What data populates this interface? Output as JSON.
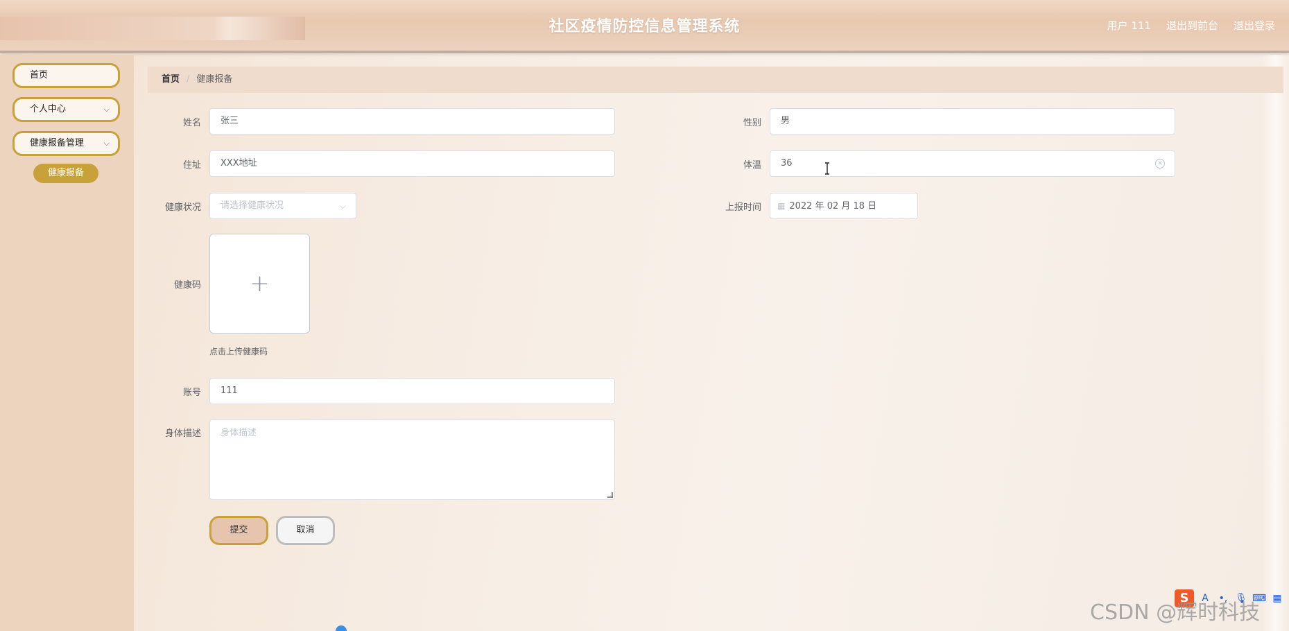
{
  "header": {
    "title": "社区疫情防控信息管理系统",
    "user": "用户 111",
    "back_to_front": "退出到前台",
    "logout": "退出登录"
  },
  "sidebar": {
    "items": [
      {
        "label": "首页"
      },
      {
        "label": "个人中心"
      },
      {
        "label": "健康报备管理"
      }
    ],
    "sub_items": [
      {
        "label": "健康报备"
      }
    ]
  },
  "breadcrumb": {
    "home": "首页",
    "separator": "/",
    "current": "健康报备"
  },
  "form": {
    "name": {
      "label": "姓名",
      "value": "张三"
    },
    "gender": {
      "label": "性别",
      "value": "男"
    },
    "address": {
      "label": "住址",
      "value": "XXX地址"
    },
    "temperature": {
      "label": "体温",
      "value": "36"
    },
    "health_status": {
      "label": "健康状况",
      "placeholder": "请选择健康状况"
    },
    "report_time": {
      "label": "上报时间",
      "value": "2022 年 02 月 18 日"
    },
    "health_code": {
      "label": "健康码",
      "upload_tip": "点击上传健康码"
    },
    "account": {
      "label": "账号",
      "value": "111"
    },
    "description": {
      "label": "身体描述",
      "placeholder": "身体描述"
    },
    "submit": "提交",
    "cancel": "取消"
  },
  "overlay": {
    "watermark": "CSDN @辉时科技",
    "ime_logo": "S"
  }
}
